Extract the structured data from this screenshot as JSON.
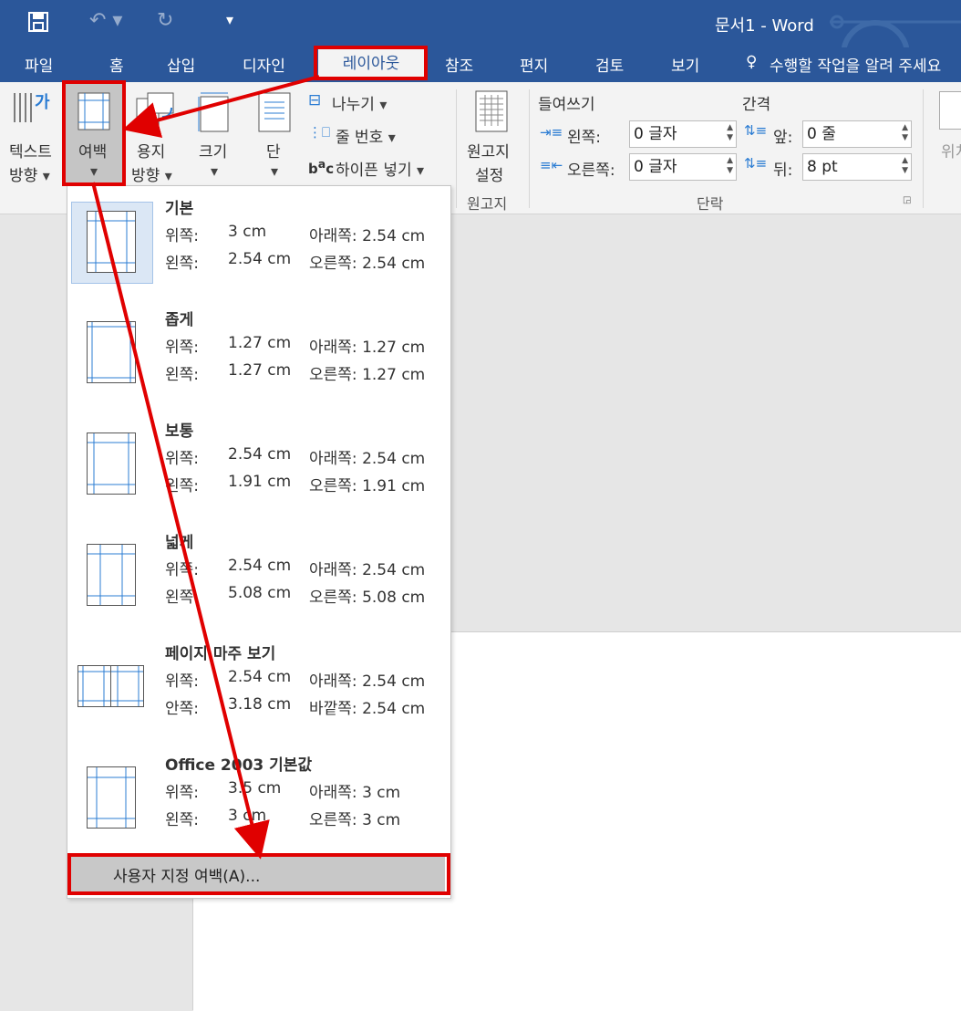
{
  "window": {
    "title": "문서1 - Word"
  },
  "tabs": [
    "파일",
    "홈",
    "삽입",
    "디자인",
    "레이아웃",
    "참조",
    "편지",
    "검토",
    "보기"
  ],
  "tell_me": "수행할 작업을 알려 주세요",
  "ribbon": {
    "text_direction": [
      "텍스트",
      "방향"
    ],
    "margins": "여백",
    "orientation": [
      "용지",
      "방향"
    ],
    "size": "크기",
    "columns": "단",
    "breaks": "나누기",
    "line_numbers": "줄 번호",
    "hyphenation": "하이픈 넣기",
    "manuscript": [
      "원고지",
      "설정"
    ],
    "manuscript_group": "원고지",
    "indent_label": "들여쓰기",
    "spacing_label": "간격",
    "indent_left_label": "왼쪽:",
    "indent_right_label": "오른쪽:",
    "indent_left_value": "0 글자",
    "indent_right_value": "0 글자",
    "space_before_label": "앞:",
    "space_after_label": "뒤:",
    "space_before_value": "0 줄",
    "space_after_value": "8 pt",
    "paragraph_group": "단락",
    "position_cut": "위치"
  },
  "margins_menu": [
    {
      "name": "기본",
      "l1a": "위쪽:",
      "v1a": "3 cm",
      "l1b": "아래쪽:",
      "v1b": "2.54 cm",
      "l2a": "왼쪽:",
      "v2a": "2.54 cm",
      "l2b": "오른쪽:",
      "v2b": "2.54 cm"
    },
    {
      "name": "좁게",
      "l1a": "위쪽:",
      "v1a": "1.27 cm",
      "l1b": "아래쪽:",
      "v1b": "1.27 cm",
      "l2a": "왼쪽:",
      "v2a": "1.27 cm",
      "l2b": "오른쪽:",
      "v2b": "1.27 cm"
    },
    {
      "name": "보통",
      "l1a": "위쪽:",
      "v1a": "2.54 cm",
      "l1b": "아래쪽:",
      "v1b": "2.54 cm",
      "l2a": "왼쪽:",
      "v2a": "1.91 cm",
      "l2b": "오른쪽:",
      "v2b": "1.91 cm"
    },
    {
      "name": "넓게",
      "l1a": "위쪽:",
      "v1a": "2.54 cm",
      "l1b": "아래쪽:",
      "v1b": "2.54 cm",
      "l2a": "왼쪽:",
      "v2a": "5.08 cm",
      "l2b": "오른쪽:",
      "v2b": "5.08 cm"
    },
    {
      "name": "페이지 마주 보기",
      "l1a": "위쪽:",
      "v1a": "2.54 cm",
      "l1b": "아래쪽:",
      "v1b": "2.54 cm",
      "l2a": "안쪽:",
      "v2a": "3.18 cm",
      "l2b": "바깥쪽:",
      "v2b": "2.54 cm"
    },
    {
      "name": "Office 2003 기본값",
      "l1a": "위쪽:",
      "v1a": "3.5 cm",
      "l1b": "아래쪽:",
      "v1b": "3 cm",
      "l2a": "왼쪽:",
      "v2a": "3 cm",
      "l2b": "오른쪽:",
      "v2b": "3 cm"
    }
  ],
  "custom_margins": "사용자 지정 여백(A)...",
  "annotation_color": "#e00000",
  "accent": "#2b579a"
}
